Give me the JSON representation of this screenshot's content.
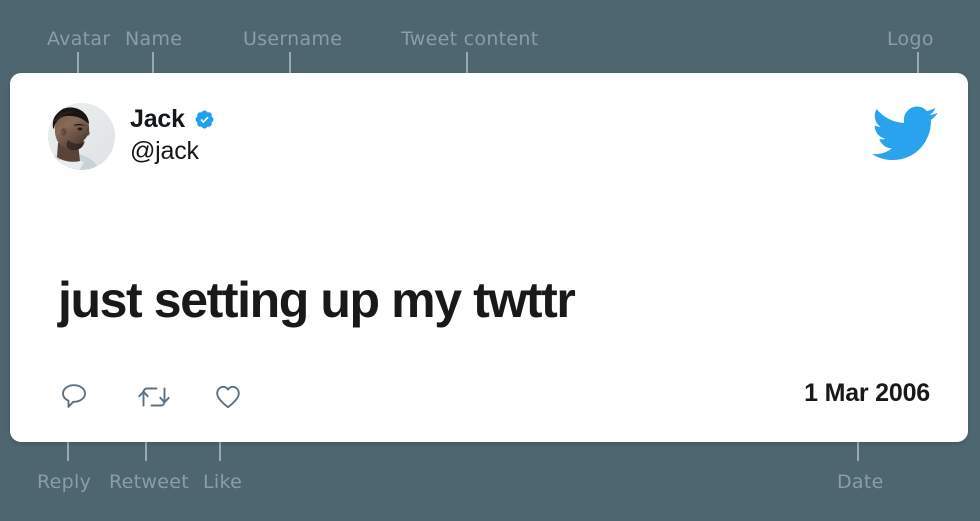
{
  "theme": {
    "background": "#4d6670",
    "card_background": "#ffffff",
    "annotation_text": "#8d9da6",
    "leader_line": "#9aa9b5",
    "brand_blue": "#1da1f2",
    "text_primary": "#14171a",
    "action_icon": "#5b7184"
  },
  "annotations": [
    {
      "id": "avatar",
      "label": "Avatar"
    },
    {
      "id": "name",
      "label": "Name"
    },
    {
      "id": "username",
      "label": "Username"
    },
    {
      "id": "tweet-content",
      "label": "Tweet content"
    },
    {
      "id": "logo",
      "label": "Logo"
    },
    {
      "id": "reply",
      "label": "Reply"
    },
    {
      "id": "retweet",
      "label": "Retweet"
    },
    {
      "id": "like",
      "label": "Like"
    },
    {
      "id": "date",
      "label": "Date"
    }
  ],
  "tweet": {
    "author": {
      "display_name": "Jack",
      "handle": "@jack",
      "verified": true,
      "avatar_alt": "avatar-photo"
    },
    "text": "just setting up my twttr",
    "date": "1 Mar 2006",
    "logo_name": "twitter-bird-logo",
    "actions": [
      {
        "id": "reply",
        "icon": "reply-icon",
        "label": "Reply"
      },
      {
        "id": "retweet",
        "icon": "retweet-icon",
        "label": "Retweet"
      },
      {
        "id": "like",
        "icon": "like-heart-icon",
        "label": "Like"
      }
    ]
  }
}
